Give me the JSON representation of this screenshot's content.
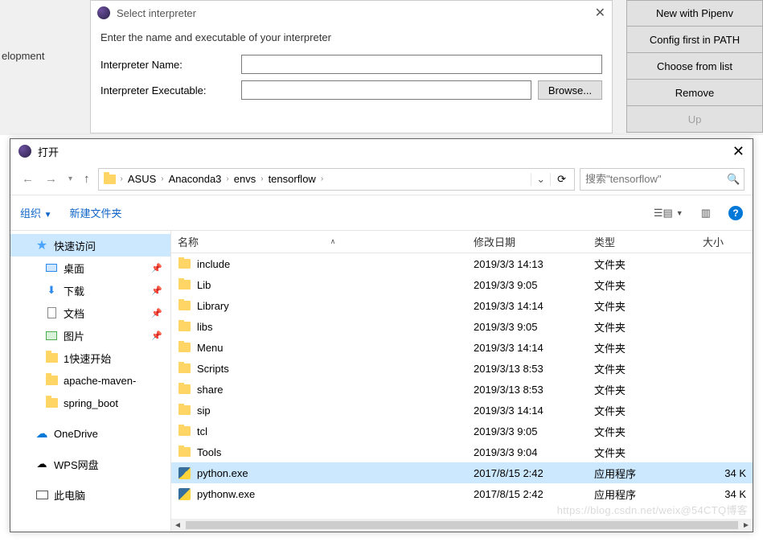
{
  "bg": {
    "left_text": "elopment"
  },
  "side_buttons": [
    "New with Pipenv",
    "Config first in PATH",
    "Choose from list",
    "Remove",
    "Up"
  ],
  "eclipse": {
    "title": "Select interpreter",
    "instruction": "Enter the name and executable of your interpreter",
    "name_label": "Interpreter Name:",
    "exec_label": "Interpreter Executable:",
    "browse": "Browse...",
    "name_value": "",
    "exec_value": ""
  },
  "file_dialog": {
    "title": "打开",
    "breadcrumb": [
      "ASUS",
      "Anaconda3",
      "envs",
      "tensorflow"
    ],
    "search_placeholder": "搜索\"tensorflow\"",
    "organize": "组织",
    "new_folder": "新建文件夹",
    "columns": {
      "name": "名称",
      "date": "修改日期",
      "type": "类型",
      "size": "大小"
    },
    "nav": {
      "quick": "快速访问",
      "items": [
        {
          "label": "桌面",
          "icon": "desk"
        },
        {
          "label": "下载",
          "icon": "down"
        },
        {
          "label": "文档",
          "icon": "doc"
        },
        {
          "label": "图片",
          "icon": "pic"
        },
        {
          "label": "1快速开始",
          "icon": "folder"
        },
        {
          "label": "apache-maven-",
          "icon": "folder"
        },
        {
          "label": "spring_boot",
          "icon": "folder"
        }
      ],
      "onedrive": "OneDrive",
      "wps": "WPS网盘",
      "thispc": "此电脑"
    },
    "files": [
      {
        "name": "include",
        "date": "2019/3/3 14:13",
        "type": "文件夹",
        "size": "",
        "icon": "folder",
        "selected": false
      },
      {
        "name": "Lib",
        "date": "2019/3/3 9:05",
        "type": "文件夹",
        "size": "",
        "icon": "folder",
        "selected": false
      },
      {
        "name": "Library",
        "date": "2019/3/3 14:14",
        "type": "文件夹",
        "size": "",
        "icon": "folder",
        "selected": false
      },
      {
        "name": "libs",
        "date": "2019/3/3 9:05",
        "type": "文件夹",
        "size": "",
        "icon": "folder",
        "selected": false
      },
      {
        "name": "Menu",
        "date": "2019/3/3 14:14",
        "type": "文件夹",
        "size": "",
        "icon": "folder",
        "selected": false
      },
      {
        "name": "Scripts",
        "date": "2019/3/13 8:53",
        "type": "文件夹",
        "size": "",
        "icon": "folder",
        "selected": false
      },
      {
        "name": "share",
        "date": "2019/3/13 8:53",
        "type": "文件夹",
        "size": "",
        "icon": "folder",
        "selected": false
      },
      {
        "name": "sip",
        "date": "2019/3/3 14:14",
        "type": "文件夹",
        "size": "",
        "icon": "folder",
        "selected": false
      },
      {
        "name": "tcl",
        "date": "2019/3/3 9:05",
        "type": "文件夹",
        "size": "",
        "icon": "folder",
        "selected": false
      },
      {
        "name": "Tools",
        "date": "2019/3/3 9:04",
        "type": "文件夹",
        "size": "",
        "icon": "folder",
        "selected": false
      },
      {
        "name": "python.exe",
        "date": "2017/8/15 2:42",
        "type": "应用程序",
        "size": "34 K",
        "icon": "py",
        "selected": true
      },
      {
        "name": "pythonw.exe",
        "date": "2017/8/15 2:42",
        "type": "应用程序",
        "size": "34 K",
        "icon": "py",
        "selected": false
      }
    ]
  },
  "watermark": "https://blog.csdn.net/weix@54CTQ博客"
}
